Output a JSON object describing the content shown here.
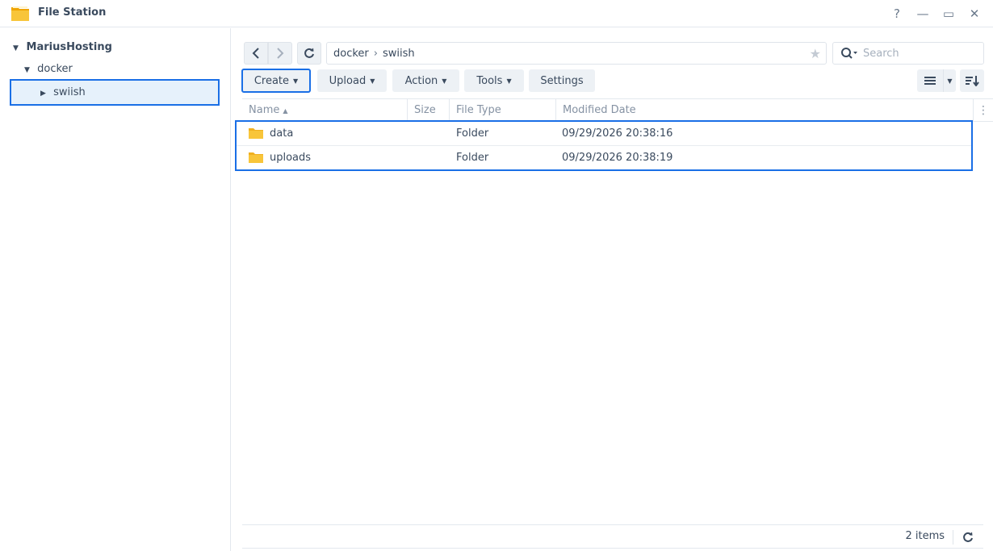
{
  "window": {
    "title": "File Station",
    "help": "?",
    "minimize": "—",
    "maximize": "▭",
    "close": "✕"
  },
  "sidebar": {
    "root": "MariusHosting",
    "items": [
      {
        "label": "docker"
      },
      {
        "label": "swiish"
      }
    ]
  },
  "pathbar": {
    "segments": [
      "docker",
      "swiish"
    ]
  },
  "search": {
    "placeholder": "Search"
  },
  "toolbar": {
    "create": "Create",
    "upload": "Upload",
    "action": "Action",
    "tools": "Tools",
    "settings": "Settings"
  },
  "grid": {
    "columns": [
      "Name",
      "Size",
      "File Type",
      "Modified Date"
    ],
    "rows": [
      {
        "name": "data",
        "size": "",
        "type": "Folder",
        "modified": "09/29/2026 20:38:16"
      },
      {
        "name": "uploads",
        "size": "",
        "type": "Folder",
        "modified": "09/29/2026 20:38:19"
      }
    ]
  },
  "footer": {
    "count": "2 items"
  },
  "colors": {
    "accent": "#1a6fe6",
    "folder": "#f8c53a",
    "selected_bg": "#e6f1fb"
  }
}
